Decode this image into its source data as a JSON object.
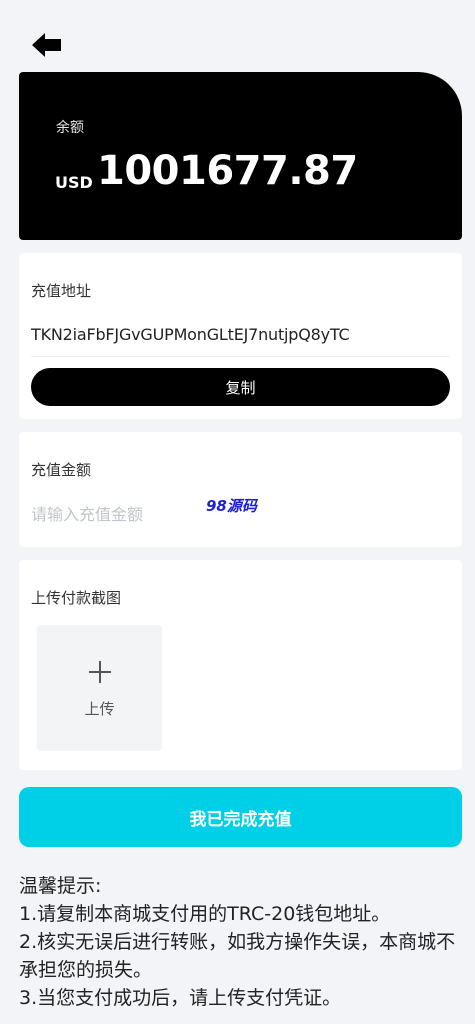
{
  "header": {
    "back_icon": "arrow-left-icon"
  },
  "balance": {
    "label": "余额",
    "currency": "USD",
    "amount": "1001677.87"
  },
  "address_section": {
    "title": "充值地址",
    "address": "TKN2iaFbFJGvGUPMonGLtEJ7nutjpQ8yTC",
    "copy_label": "复制"
  },
  "amount_section": {
    "title": "充值金额",
    "placeholder": "请输入充值金额",
    "value": "",
    "watermark": "98源码"
  },
  "upload_section": {
    "title": "上传付款截图",
    "upload_label": "上传",
    "upload_icon": "plus-icon"
  },
  "submit": {
    "label": "我已完成充值"
  },
  "tips": {
    "title": "温馨提示:",
    "items": [
      "1.请复制本商城支付用的TRC-20钱包地址。",
      "2.核实无误后进行转账，如我方操作失误，本商城不承担您的损失。",
      "3.当您支付成功后，请上传支付凭证。"
    ]
  },
  "colors": {
    "background": "#f2f4f7",
    "balance_card": "#000000",
    "copy_button": "#000000",
    "submit_button": "#00cfe8",
    "watermark": "#1d1dd6"
  }
}
